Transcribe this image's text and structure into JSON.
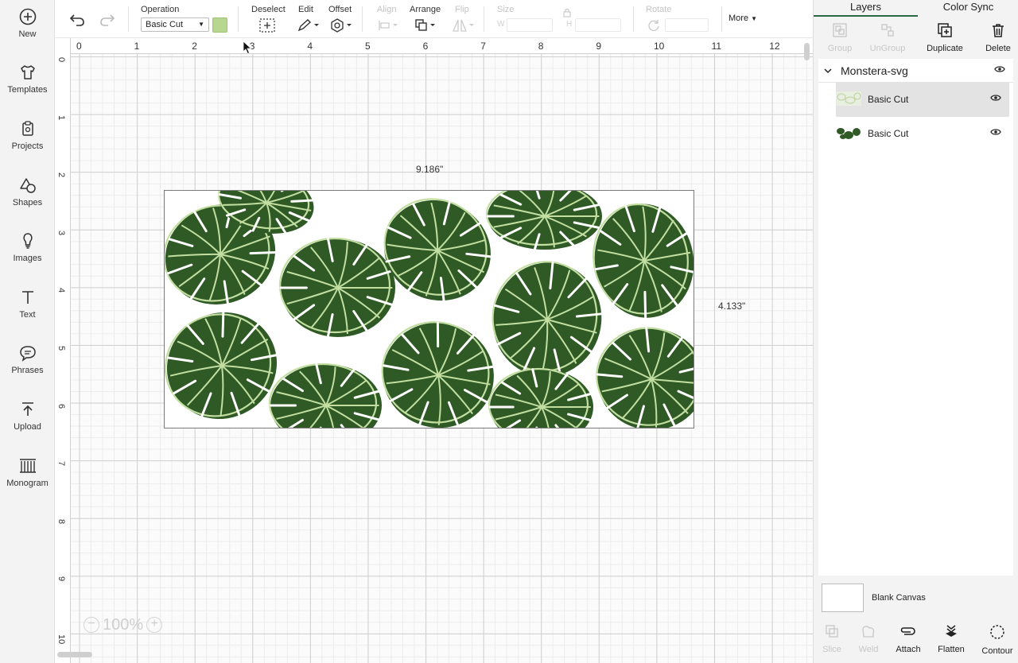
{
  "sidebar": {
    "items": [
      {
        "label": "New",
        "icon": "plus-circle-icon"
      },
      {
        "label": "Templates",
        "icon": "tshirt-icon"
      },
      {
        "label": "Projects",
        "icon": "clipboard-icon"
      },
      {
        "label": "Shapes",
        "icon": "shapes-icon"
      },
      {
        "label": "Images",
        "icon": "lightbulb-icon"
      },
      {
        "label": "Text",
        "icon": "text-t-icon"
      },
      {
        "label": "Phrases",
        "icon": "speech-bubble-icon"
      },
      {
        "label": "Upload",
        "icon": "upload-icon"
      },
      {
        "label": "Monogram",
        "icon": "monogram-icon"
      }
    ]
  },
  "toolbar": {
    "operation_label": "Operation",
    "operation_value": "Basic Cut",
    "operation_color": "#b7d68f",
    "deselect_label": "Deselect",
    "edit_label": "Edit",
    "offset_label": "Offset",
    "align_label": "Align",
    "arrange_label": "Arrange",
    "flip_label": "Flip",
    "size_label": "Size",
    "size_w": "W",
    "size_h": "H",
    "rotate_label": "Rotate",
    "more_label": "More"
  },
  "canvas": {
    "ruler_top": [
      "0",
      "1",
      "2",
      "3",
      "4",
      "5",
      "6",
      "7",
      "8",
      "9",
      "10",
      "11",
      "12"
    ],
    "ruler_left": [
      "0",
      "1",
      "2",
      "3",
      "4",
      "5",
      "6",
      "7",
      "8",
      "9",
      "10"
    ],
    "width_label": "9.186\"",
    "height_label": "4.133\"",
    "zoom_label": "100%",
    "leaf_dark": "#2f5a26",
    "leaf_light": "#c2dea0"
  },
  "panel": {
    "tabs": [
      "Layers",
      "Color Sync"
    ],
    "tools": [
      {
        "label": "Group",
        "enabled": false
      },
      {
        "label": "UnGroup",
        "enabled": false
      },
      {
        "label": "Duplicate",
        "enabled": true
      },
      {
        "label": "Delete",
        "enabled": true
      }
    ],
    "group_name": "Monstera-svg",
    "layers": [
      {
        "name": "Basic Cut",
        "selected": true
      },
      {
        "name": "Basic Cut",
        "selected": false
      }
    ],
    "canvas_label": "Blank Canvas",
    "bottom_tools": [
      {
        "label": "Slice",
        "enabled": false
      },
      {
        "label": "Weld",
        "enabled": false
      },
      {
        "label": "Attach",
        "enabled": true
      },
      {
        "label": "Flatten",
        "enabled": true
      },
      {
        "label": "Contour",
        "enabled": true
      }
    ]
  }
}
